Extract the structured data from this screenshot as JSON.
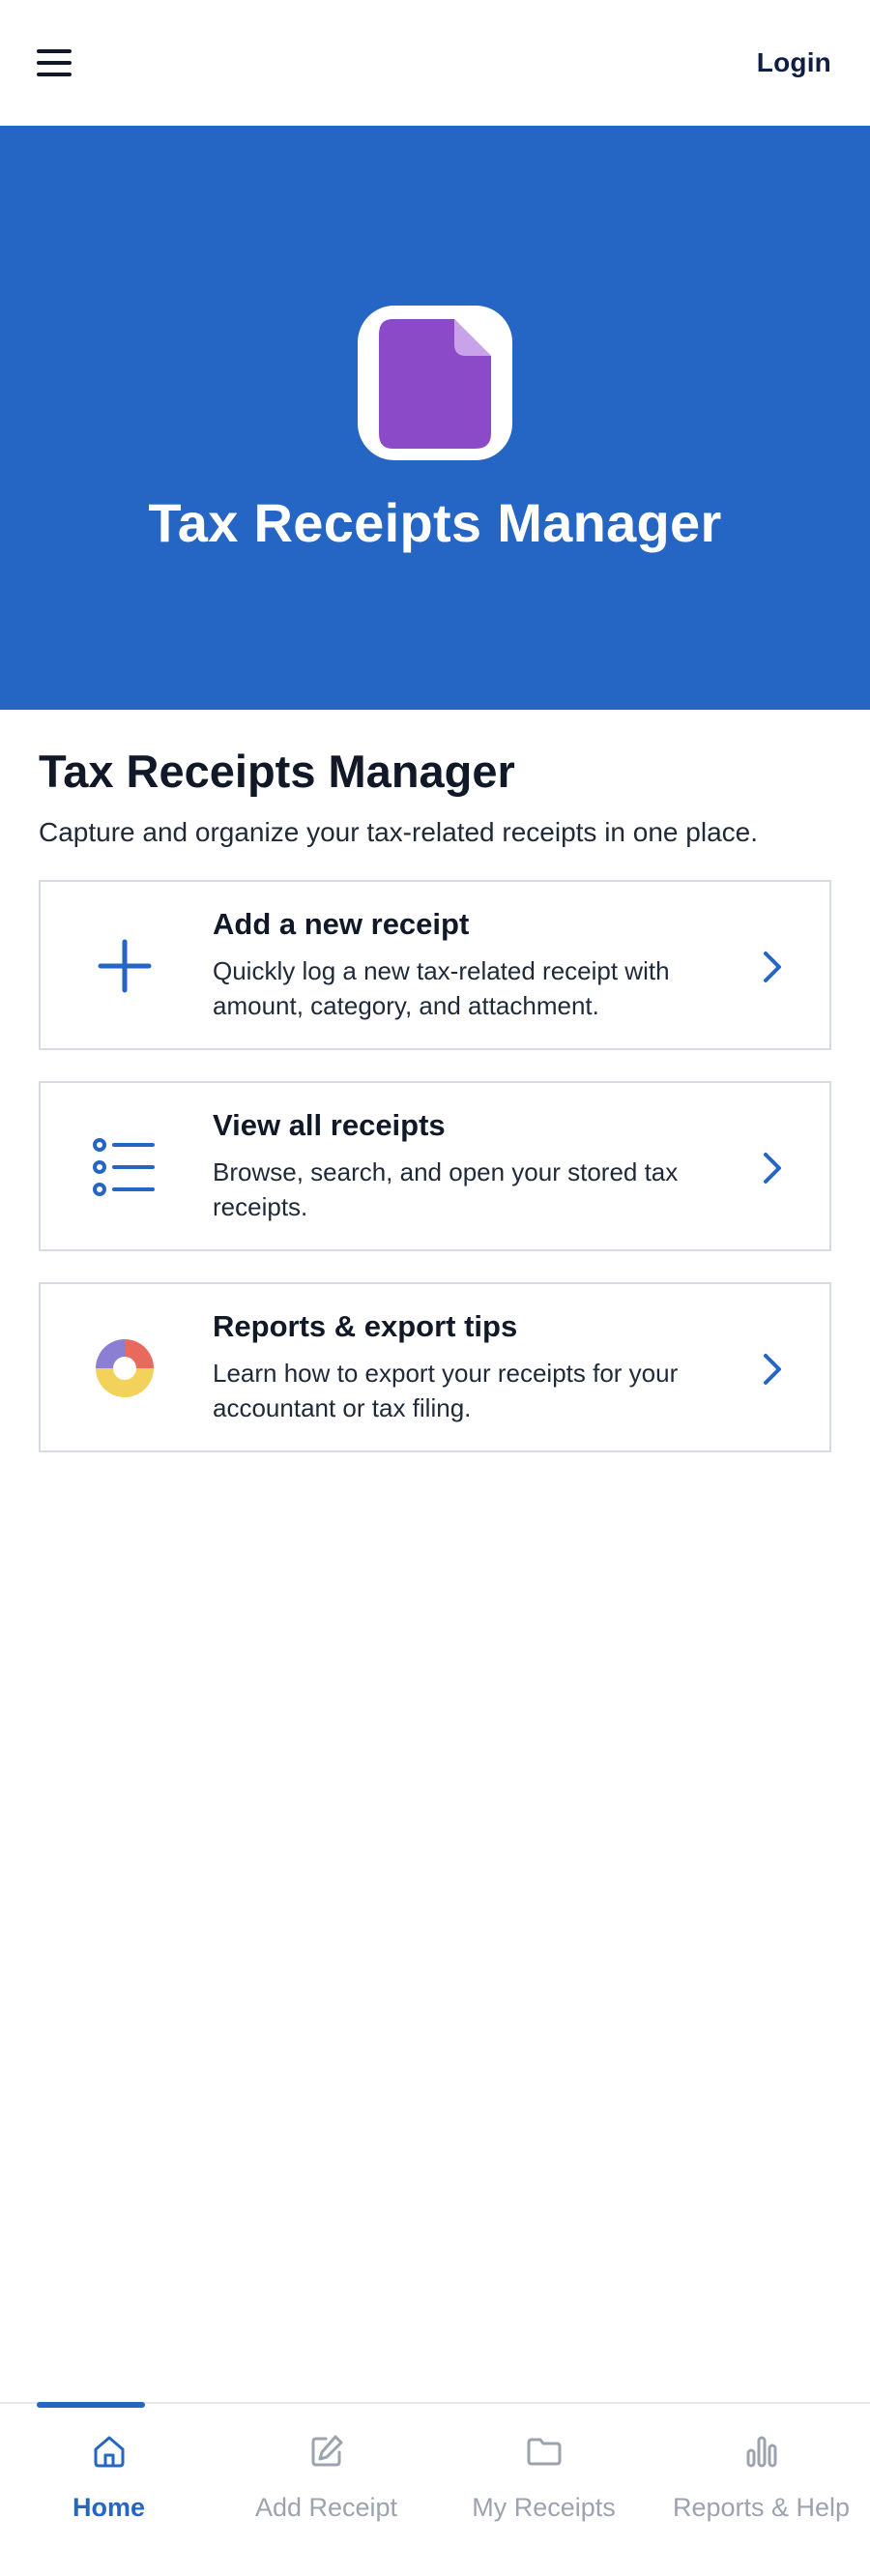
{
  "topbar": {
    "login_label": "Login"
  },
  "hero": {
    "title": "Tax Receipts Manager"
  },
  "main": {
    "title": "Tax Receipts Manager",
    "subtitle": "Capture and organize your tax-related receipts in one place.",
    "cards": [
      {
        "title": "Add a new receipt",
        "description": "Quickly log a new tax-related receipt with amount, category, and attachment.",
        "icon": "plus-icon"
      },
      {
        "title": "View all receipts",
        "description": "Browse, search, and open your stored tax receipts.",
        "icon": "list-icon"
      },
      {
        "title": "Reports & export tips",
        "description": "Learn how to export your receipts for your accountant or tax filing.",
        "icon": "pie-chart-icon"
      }
    ]
  },
  "bottom_nav": {
    "items": [
      {
        "label": "Home",
        "icon": "home-icon",
        "active": true
      },
      {
        "label": "Add Receipt",
        "icon": "pencil-icon",
        "active": false
      },
      {
        "label": "My Receipts",
        "icon": "folder-icon",
        "active": false
      },
      {
        "label": "Reports & Help",
        "icon": "bar-chart-icon",
        "active": false
      }
    ]
  },
  "colors": {
    "primary": "#2565c4",
    "hero_icon": "#8b4bc9",
    "text_dark": "#111827",
    "nav_inactive": "#9ca3af"
  }
}
